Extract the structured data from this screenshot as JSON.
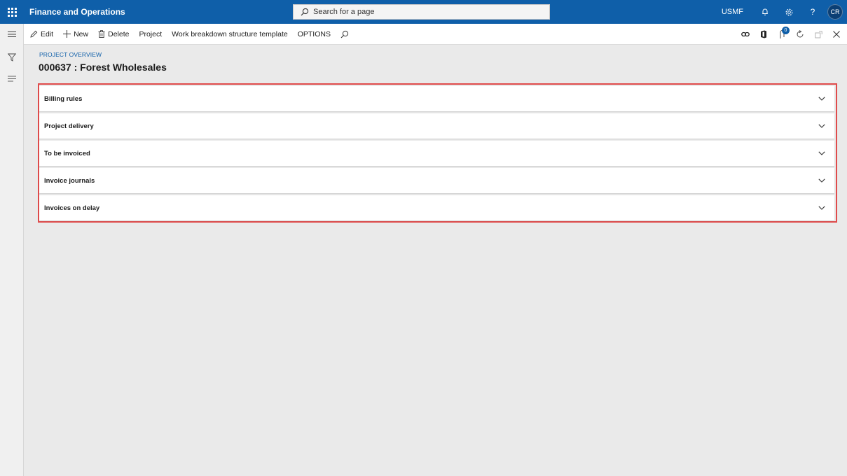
{
  "app": {
    "title": "Finance and Operations",
    "search_placeholder": "Search for a page",
    "company": "USMF",
    "user_initials": "CR"
  },
  "actions": {
    "edit": "Edit",
    "new": "New",
    "delete": "Delete",
    "project": "Project",
    "wbs_template": "Work breakdown structure template",
    "options": "OPTIONS",
    "notification_count": "0"
  },
  "page": {
    "caption": "PROJECT OVERVIEW",
    "title": "000637 : Forest Wholesales"
  },
  "sections": [
    {
      "label": "Billing rules"
    },
    {
      "label": "Project delivery"
    },
    {
      "label": "To be invoiced"
    },
    {
      "label": "Invoice journals"
    },
    {
      "label": "Invoices on delay"
    }
  ],
  "colors": {
    "nav_bar": "#0f5fa9",
    "highlight_border": "#e04b4b",
    "caption_text": "#0f5fa9"
  }
}
